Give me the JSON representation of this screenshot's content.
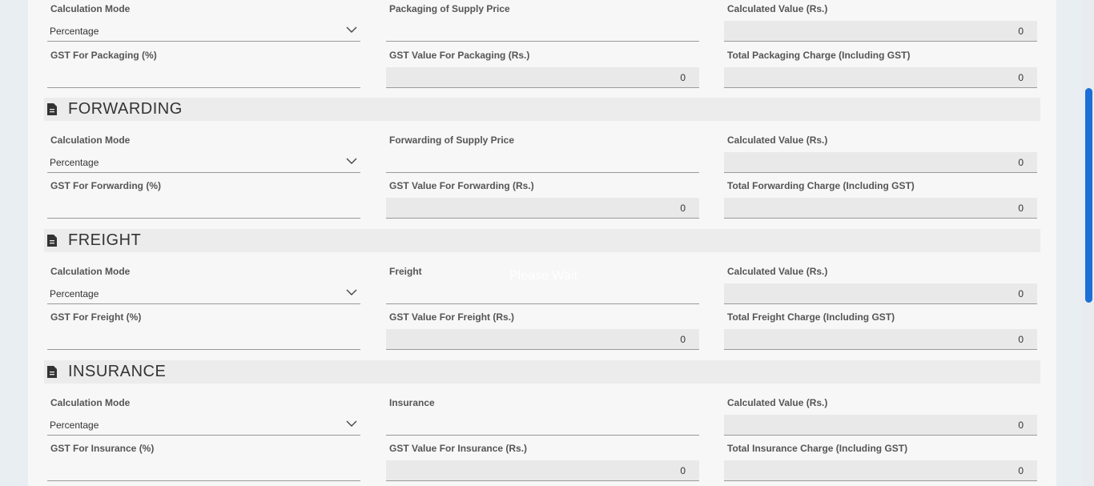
{
  "packaging": {
    "calc_mode_label": "Calculation Mode",
    "calc_mode_value": "Percentage",
    "supply_price_label": "Packaging of Supply Price",
    "supply_price_value": "",
    "calculated_label": "Calculated Value (Rs.)",
    "calculated_value": "0",
    "gst_pct_label": "GST For Packaging (%)",
    "gst_pct_value": "",
    "gst_value_label": "GST Value For Packaging (Rs.)",
    "gst_value": "0",
    "total_label": "Total Packaging Charge (Including GST)",
    "total_value": "0"
  },
  "forwarding": {
    "title": "FORWARDING",
    "calc_mode_label": "Calculation Mode",
    "calc_mode_value": "Percentage",
    "supply_price_label": "Forwarding of Supply Price",
    "supply_price_value": "",
    "calculated_label": "Calculated Value (Rs.)",
    "calculated_value": "0",
    "gst_pct_label": "GST For Forwarding (%)",
    "gst_pct_value": "",
    "gst_value_label": "GST Value For Forwarding (Rs.)",
    "gst_value": "0",
    "total_label": "Total Forwarding Charge (Including GST)",
    "total_value": "0"
  },
  "freight": {
    "title": "FREIGHT",
    "calc_mode_label": "Calculation Mode",
    "calc_mode_value": "Percentage",
    "supply_price_label": "Freight",
    "supply_price_value": "",
    "calculated_label": "Calculated Value (Rs.)",
    "calculated_value": "0",
    "gst_pct_label": "GST For Freight (%)",
    "gst_pct_value": "",
    "gst_value_label": "GST Value For Freight (Rs.)",
    "gst_value": "0",
    "total_label": "Total Freight Charge (Including GST)",
    "total_value": "0"
  },
  "insurance": {
    "title": "INSURANCE",
    "calc_mode_label": "Calculation Mode",
    "calc_mode_value": "Percentage",
    "supply_price_label": "Insurance",
    "supply_price_value": "",
    "calculated_label": "Calculated Value (Rs.)",
    "calculated_value": "0",
    "gst_pct_label": "GST For Insurance (%)",
    "gst_pct_value": "",
    "gst_value_label": "GST Value For Insurance (Rs.)",
    "gst_value": "0",
    "total_label": "Total Insurance Charge (Including GST)",
    "total_value": "0"
  },
  "overlay": {
    "text": "Please Wait"
  },
  "icons": {
    "section": "document-icon",
    "select": "chevron-down-icon"
  },
  "colors": {
    "accent": "#1b6fd6",
    "readonly_bg": "#e9e9e9",
    "section_bg": "#ececec"
  }
}
